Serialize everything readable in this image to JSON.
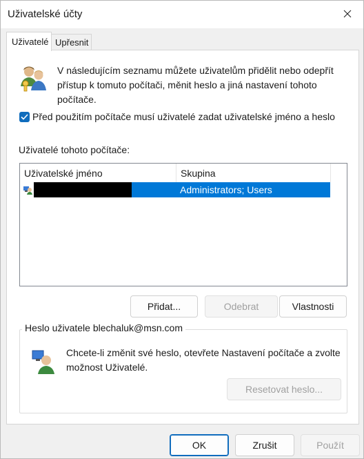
{
  "window": {
    "title": "Uživatelské účty"
  },
  "tabs": [
    {
      "label": "Uživatelé"
    },
    {
      "label": "Upřesnit"
    }
  ],
  "intro_text": "V následujícím seznamu můžete uživatelům přidělit nebo odepřít přístup k tomuto počítači, měnit heslo a jiná nastavení tohoto počítače.",
  "require_login": {
    "checked": true,
    "label": "Před použitím počítače musí uživatelé zadat uživatelské jméno a heslo"
  },
  "users_list": {
    "label": "Uživatelé tohoto počítače:",
    "columns": [
      "Uživatelské jméno",
      "Skupina"
    ],
    "rows": [
      {
        "name": "",
        "group": "Administrators; Users"
      }
    ]
  },
  "buttons": {
    "add": "Přidat...",
    "remove": "Odebrat",
    "properties": "Vlastnosti"
  },
  "password_group": {
    "title": "Heslo uživatele blechaluk@msn.com",
    "text": "Chcete-li změnit své heslo, otevřete Nastavení počítače a zvolte možnost Uživatelé.",
    "reset_button": "Resetovat heslo..."
  },
  "footer": {
    "ok": "OK",
    "cancel": "Zrušit",
    "apply": "Použít"
  },
  "colors": {
    "accent": "#0f6cbd",
    "selection": "#0078d7"
  }
}
